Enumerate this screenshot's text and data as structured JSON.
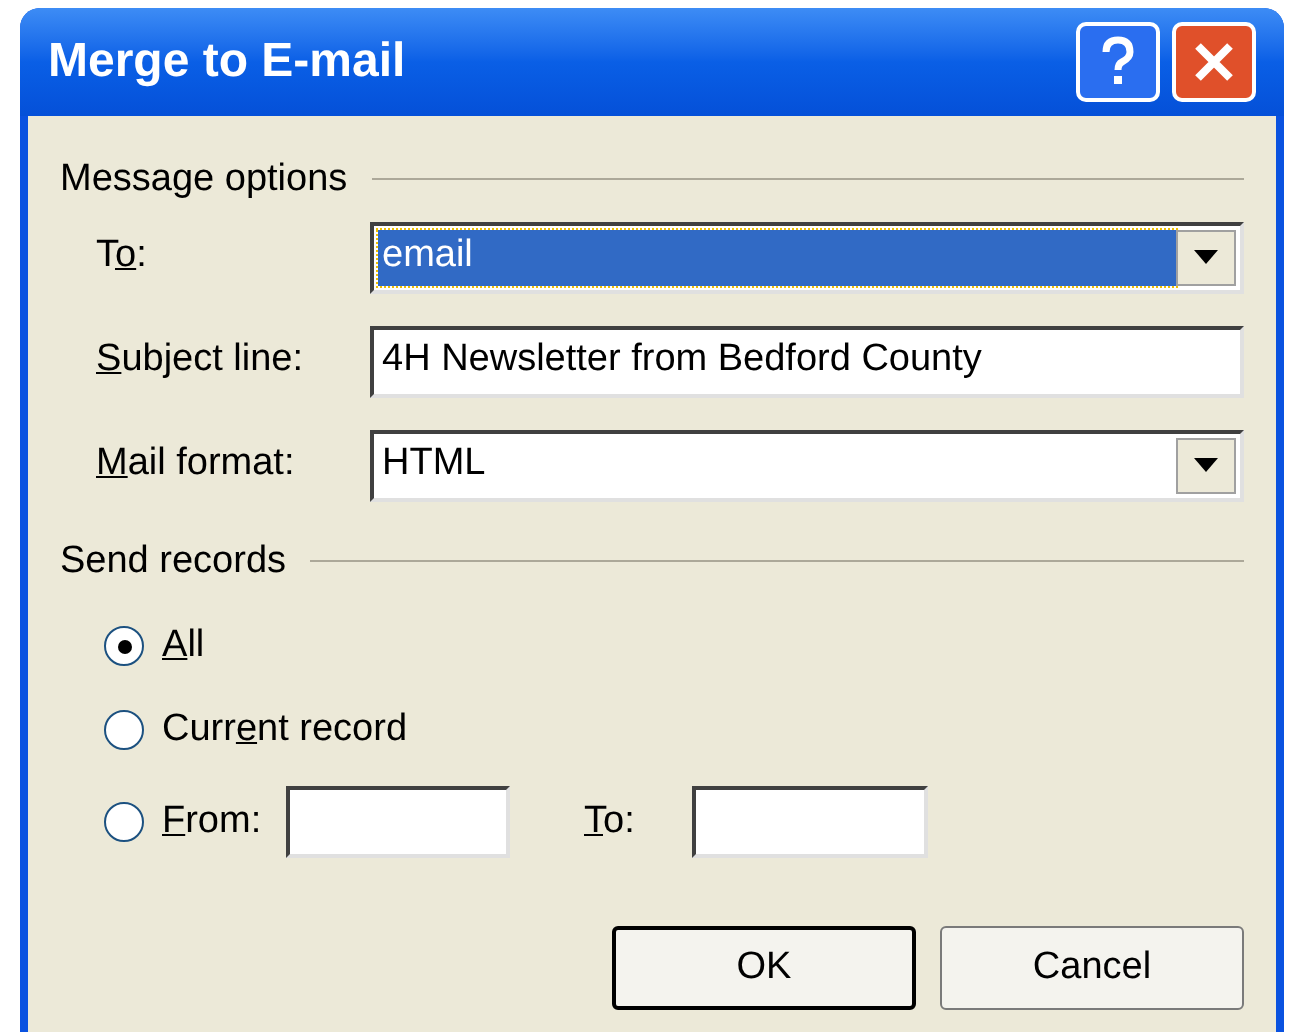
{
  "window": {
    "title": "Merge to E-mail"
  },
  "message_options": {
    "heading": "Message options",
    "fields": [
      {
        "kind": "dropdown",
        "label": {
          "before": "T",
          "key": "o",
          "after": ":"
        },
        "value": "email",
        "selected": true
      },
      {
        "kind": "text",
        "label": {
          "key": "S",
          "after": "ubject line:"
        },
        "value": "4H Newsletter from Bedford County",
        "selected": false
      },
      {
        "kind": "dropdown",
        "label": {
          "key": "M",
          "after": "ail format:"
        },
        "value": "HTML",
        "selected": false
      }
    ]
  },
  "send_records": {
    "heading": "Send records",
    "options": [
      {
        "label": {
          "key": "A",
          "after": "ll"
        },
        "selected": true
      },
      {
        "label": {
          "before": "Curr",
          "key": "e",
          "after": "nt record"
        },
        "selected": false
      },
      {
        "label": {
          "key": "F",
          "after": "rom:"
        },
        "selected": false
      }
    ],
    "to_label": {
      "key": "T",
      "after": "o:"
    }
  },
  "buttons": [
    {
      "label": "OK",
      "default": true
    },
    {
      "label": "Cancel",
      "default": false
    }
  ]
}
